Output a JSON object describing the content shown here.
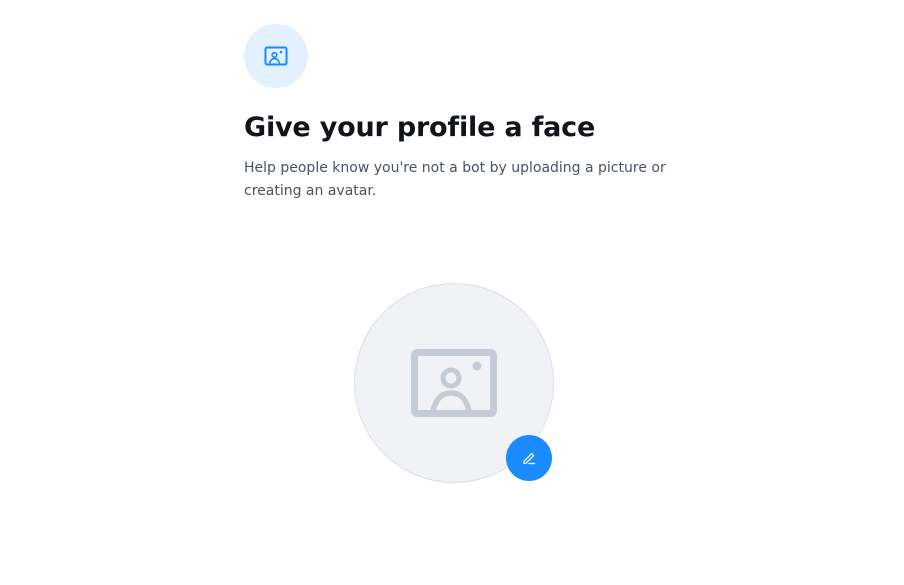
{
  "header": {
    "icon": "profile-picture-icon",
    "badge_color": "#e3f0fd",
    "icon_color": "#1a8cff"
  },
  "title": "Give your profile a face",
  "subtitle": "Help people know you're not a bot by uploading a picture or creating an avatar.",
  "avatar": {
    "placeholder_icon": "image-placeholder-icon",
    "background_color": "#f0f2f5",
    "icon_color": "#c5ccd6"
  },
  "edit_button": {
    "icon": "pencil-icon",
    "color": "#1a8cff"
  }
}
